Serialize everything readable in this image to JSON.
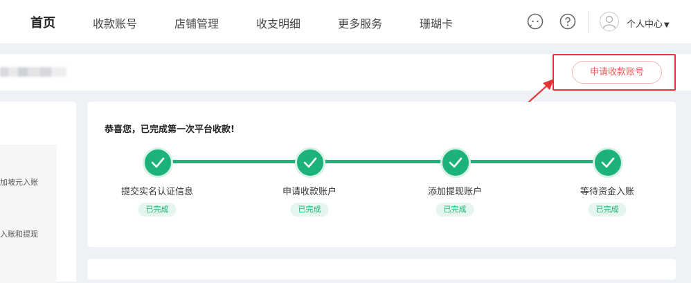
{
  "nav": {
    "items": [
      {
        "label": "首页",
        "active": true
      },
      {
        "label": "收款账号",
        "active": false
      },
      {
        "label": "店铺管理",
        "active": false
      },
      {
        "label": "收支明细",
        "active": false
      },
      {
        "label": "更多服务",
        "active": false
      },
      {
        "label": "珊瑚卡",
        "active": false
      }
    ],
    "icons": [
      "chat-icon",
      "help-icon",
      "avatar-icon"
    ],
    "personal_center": "个人中心"
  },
  "header": {
    "apply_button": "申请收款账号"
  },
  "left_panel": {
    "lines": [
      "加坡元入账",
      "入账和提现"
    ]
  },
  "progress": {
    "title": "恭喜您，已完成第一次平台收款!",
    "steps": [
      {
        "label": "提交实名认证信息",
        "status": "已完成"
      },
      {
        "label": "申请收款账户",
        "status": "已完成"
      },
      {
        "label": "添加提现账户",
        "status": "已完成"
      },
      {
        "label": "等待资金入账",
        "status": "已完成"
      }
    ]
  },
  "colors": {
    "accent_green": "#1cb37b",
    "annotation_red": "#e53535",
    "button_text": "#e85a5a"
  }
}
